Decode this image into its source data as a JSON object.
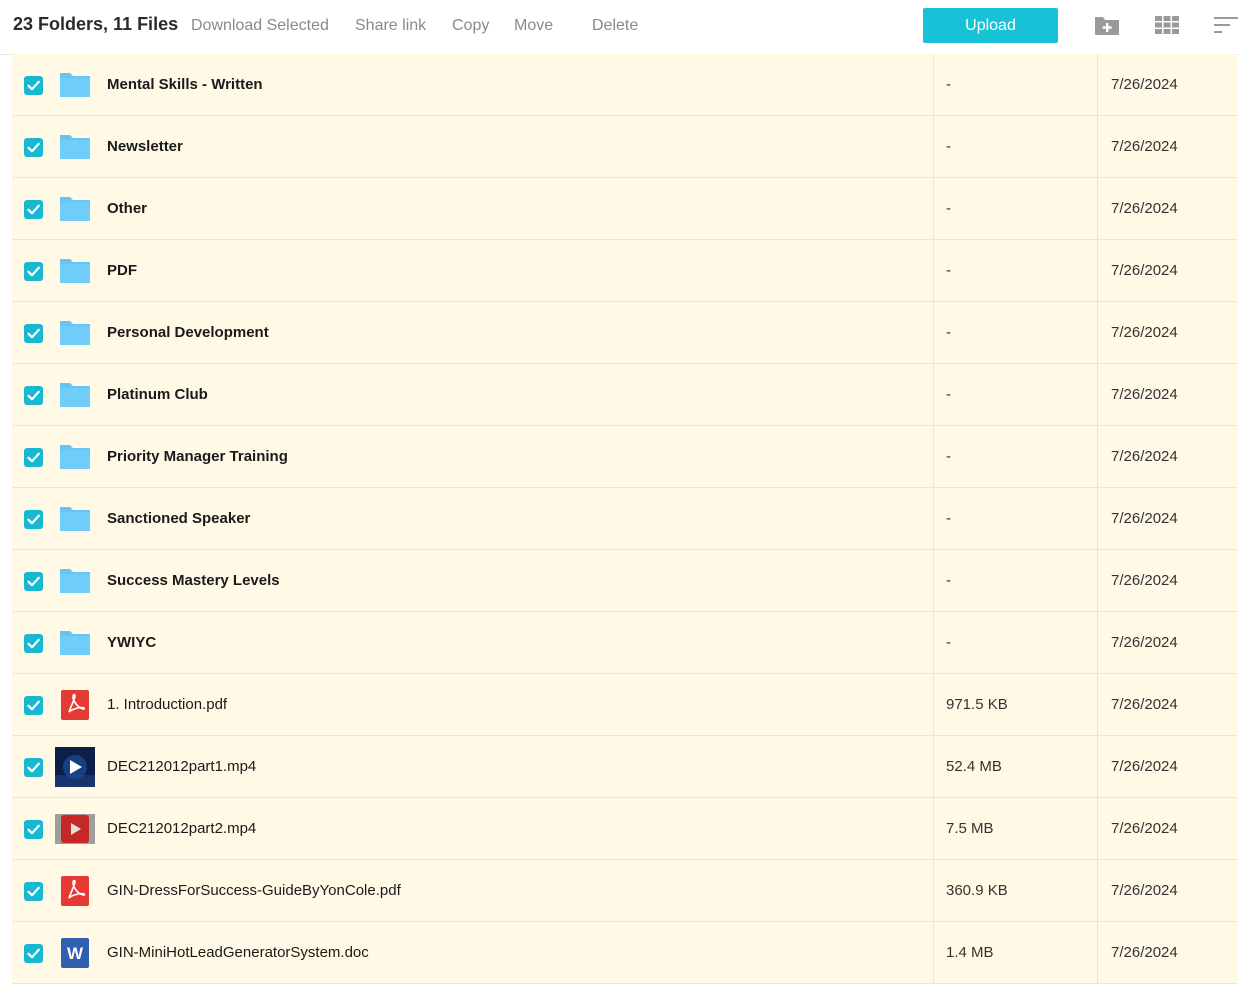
{
  "toolbar": {
    "summary": "23 Folders, 11 Files",
    "actions": [
      "Download Selected",
      "Share link",
      "Copy",
      "Move",
      "Delete"
    ],
    "upload_label": "Upload",
    "icons": [
      "new-folder-icon",
      "grid-view-icon",
      "sort-icon"
    ]
  },
  "accent_color": "#17c2d6",
  "row_highlight_color": "#fff9e6",
  "rows": [
    {
      "name": "Mental Skills - Written",
      "type": "folder",
      "size": "-",
      "date": "7/26/2024",
      "selected": true
    },
    {
      "name": "Newsletter",
      "type": "folder",
      "size": "-",
      "date": "7/26/2024",
      "selected": true
    },
    {
      "name": "Other",
      "type": "folder",
      "size": "-",
      "date": "7/26/2024",
      "selected": true
    },
    {
      "name": "PDF",
      "type": "folder",
      "size": "-",
      "date": "7/26/2024",
      "selected": true
    },
    {
      "name": "Personal Development",
      "type": "folder",
      "size": "-",
      "date": "7/26/2024",
      "selected": true
    },
    {
      "name": "Platinum Club",
      "type": "folder",
      "size": "-",
      "date": "7/26/2024",
      "selected": true
    },
    {
      "name": "Priority Manager Training",
      "type": "folder",
      "size": "-",
      "date": "7/26/2024",
      "selected": true
    },
    {
      "name": "Sanctioned Speaker",
      "type": "folder",
      "size": "-",
      "date": "7/26/2024",
      "selected": true
    },
    {
      "name": "Success Mastery Levels",
      "type": "folder",
      "size": "-",
      "date": "7/26/2024",
      "selected": true
    },
    {
      "name": "YWIYC",
      "type": "folder",
      "size": "-",
      "date": "7/26/2024",
      "selected": true
    },
    {
      "name": "1. Introduction.pdf",
      "type": "pdf",
      "size": "971.5 KB",
      "date": "7/26/2024",
      "selected": true
    },
    {
      "name": "DEC212012part1.mp4",
      "type": "video-dark",
      "size": "52.4 MB",
      "date": "7/26/2024",
      "selected": true
    },
    {
      "name": "DEC212012part2.mp4",
      "type": "video-red",
      "size": "7.5 MB",
      "date": "7/26/2024",
      "selected": true
    },
    {
      "name": "GIN-DressForSuccess-GuideByYonCole.pdf",
      "type": "pdf",
      "size": "360.9 KB",
      "date": "7/26/2024",
      "selected": true
    },
    {
      "name": "GIN-MiniHotLeadGeneratorSystem.doc",
      "type": "doc",
      "size": "1.4 MB",
      "date": "7/26/2024",
      "selected": true
    }
  ]
}
